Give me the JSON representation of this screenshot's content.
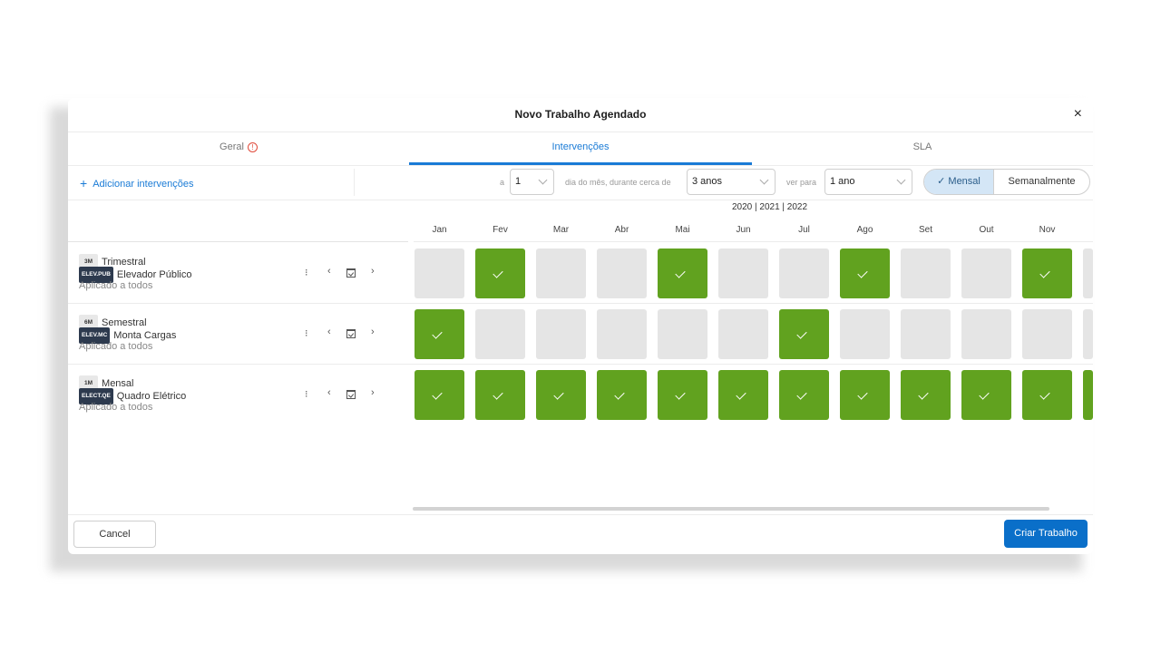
{
  "modal": {
    "title": "Novo Trabalho Agendado",
    "close_label": "×"
  },
  "tabs": [
    {
      "label": "Geral",
      "warning": true
    },
    {
      "label": "Intervenções",
      "active": true
    },
    {
      "label": "SLA"
    }
  ],
  "toolbar": {
    "add_label": "Adicionar intervenções",
    "a_label": "a",
    "day_value": "1",
    "day_month_label": "dia do mês, durante cerca de",
    "duration_value": "3 anos",
    "view_label": "ver para",
    "view_value": "1 ano",
    "toggle_monthly": "Mensal",
    "toggle_weekly": "Semanalmente",
    "active_toggle": "Mensal"
  },
  "timeline": {
    "years": "2020 | 2021 | 2022",
    "months": [
      "Jan",
      "Fev",
      "Mar",
      "Abr",
      "Mai",
      "Jun",
      "Jul",
      "Ago",
      "Set",
      "Out",
      "Nov"
    ]
  },
  "rows": [
    {
      "freq": "3M",
      "period": "Trimestral",
      "code": "ELEV.PUB",
      "name": "Elevador Público",
      "applied": "Aplicado a todos",
      "schedule": [
        0,
        1,
        0,
        0,
        1,
        0,
        0,
        1,
        0,
        0,
        1,
        0
      ]
    },
    {
      "freq": "6M",
      "period": "Semestral",
      "code": "ELEV.MC",
      "name": "Monta Cargas",
      "applied": "Aplicado a todos",
      "schedule": [
        1,
        0,
        0,
        0,
        0,
        0,
        1,
        0,
        0,
        0,
        0,
        0
      ]
    },
    {
      "freq": "1M",
      "period": "Mensal",
      "code": "ELECT.QE",
      "name": "Quadro Elétrico",
      "applied": "Aplicado a todos",
      "schedule": [
        1,
        1,
        1,
        1,
        1,
        1,
        1,
        1,
        1,
        1,
        1,
        1
      ]
    }
  ],
  "footer": {
    "cancel_label": "Cancel",
    "create_label": "Criar Trabalho"
  },
  "colors": {
    "accent": "#1a7bd6",
    "scheduled": "#61a21f",
    "empty": "#e5e5e5",
    "primary_button": "#0a6fc9",
    "code_badge": "#2d3a4e"
  }
}
